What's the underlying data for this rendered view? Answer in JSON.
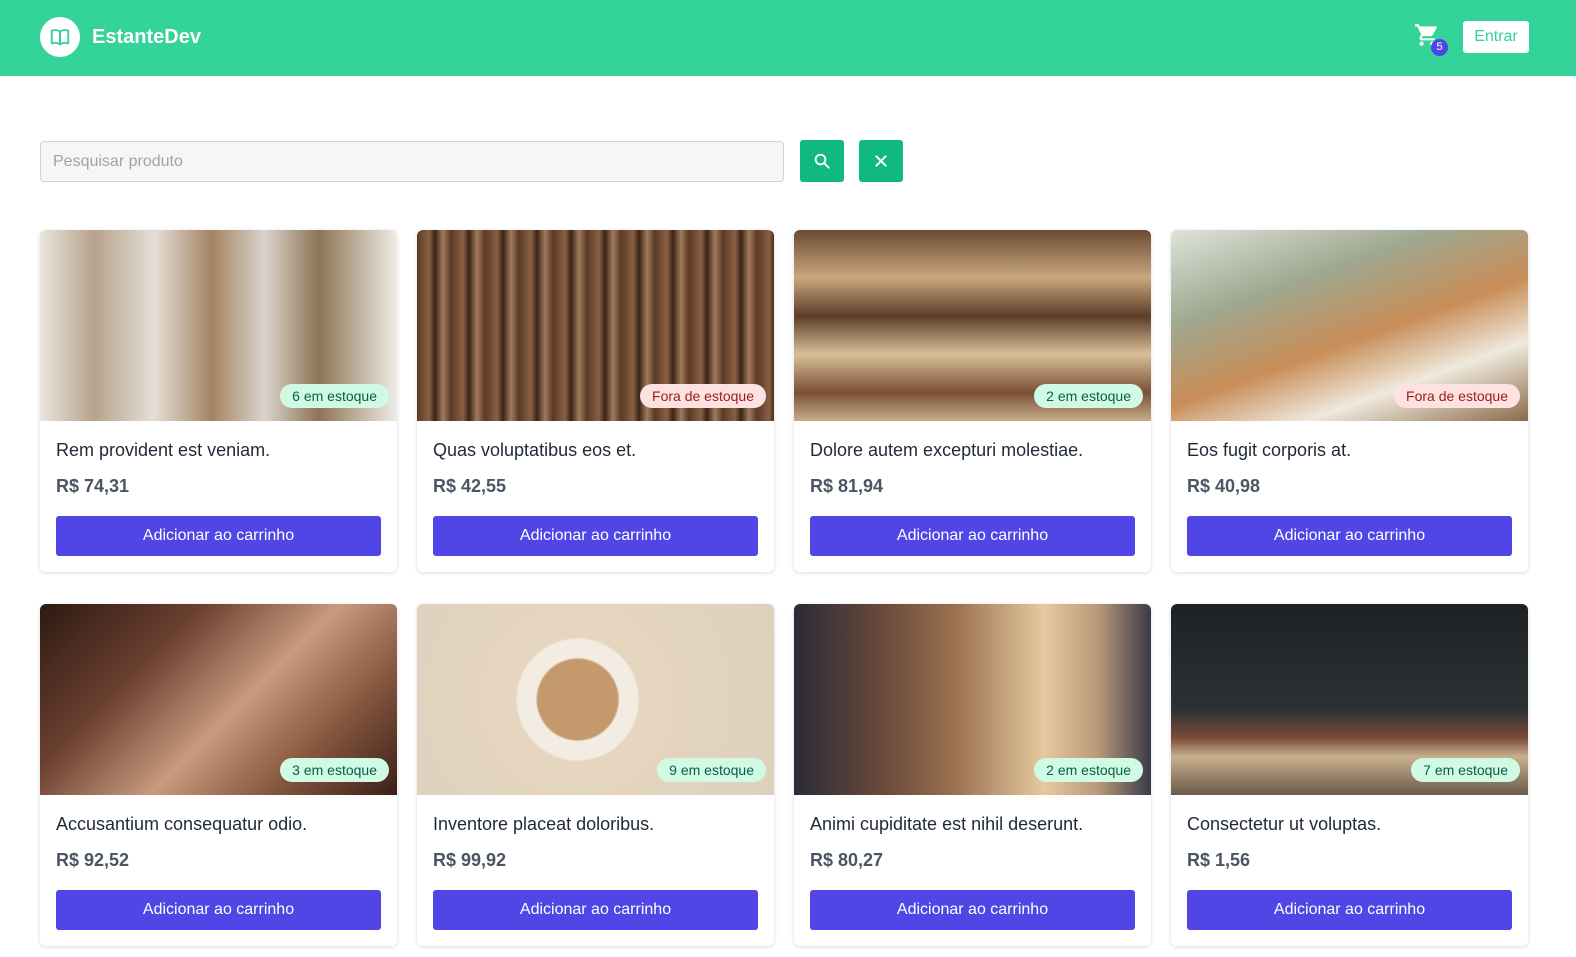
{
  "header": {
    "brand": "EstanteDev",
    "cart_count": "5",
    "login_label": "Entrar"
  },
  "search": {
    "placeholder": "Pesquisar produto"
  },
  "colors": {
    "header_bg": "#34d399",
    "primary": "#4f46e5",
    "search_btn": "#10b981",
    "in_stock_bg": "#d1fae5",
    "out_of_stock_bg": "#fee2e2"
  },
  "products": [
    {
      "title": "Rem provident est veniam.",
      "price": "R$ 74,31",
      "stock": "6 em estoque",
      "status": "in",
      "button": "Adicionar ao carrinho"
    },
    {
      "title": "Quas voluptatibus eos et.",
      "price": "R$ 42,55",
      "stock": "Fora de estoque",
      "status": "out",
      "button": "Adicionar ao carrinho"
    },
    {
      "title": "Dolore autem excepturi molestiae.",
      "price": "R$ 81,94",
      "stock": "2 em estoque",
      "status": "in",
      "button": "Adicionar ao carrinho"
    },
    {
      "title": "Eos fugit corporis at.",
      "price": "R$ 40,98",
      "stock": "Fora de estoque",
      "status": "out",
      "button": "Adicionar ao carrinho"
    },
    {
      "title": "Accusantium consequatur odio.",
      "price": "R$ 92,52",
      "stock": "3 em estoque",
      "status": "in",
      "button": "Adicionar ao carrinho"
    },
    {
      "title": "Inventore placeat doloribus.",
      "price": "R$ 99,92",
      "stock": "9 em estoque",
      "status": "in",
      "button": "Adicionar ao carrinho"
    },
    {
      "title": "Animi cupiditate est nihil deserunt.",
      "price": "R$ 80,27",
      "stock": "2 em estoque",
      "status": "in",
      "button": "Adicionar ao carrinho"
    },
    {
      "title": "Consectetur ut voluptas.",
      "price": "R$ 1,56",
      "stock": "7 em estoque",
      "status": "in",
      "button": "Adicionar ao carrinho"
    }
  ]
}
